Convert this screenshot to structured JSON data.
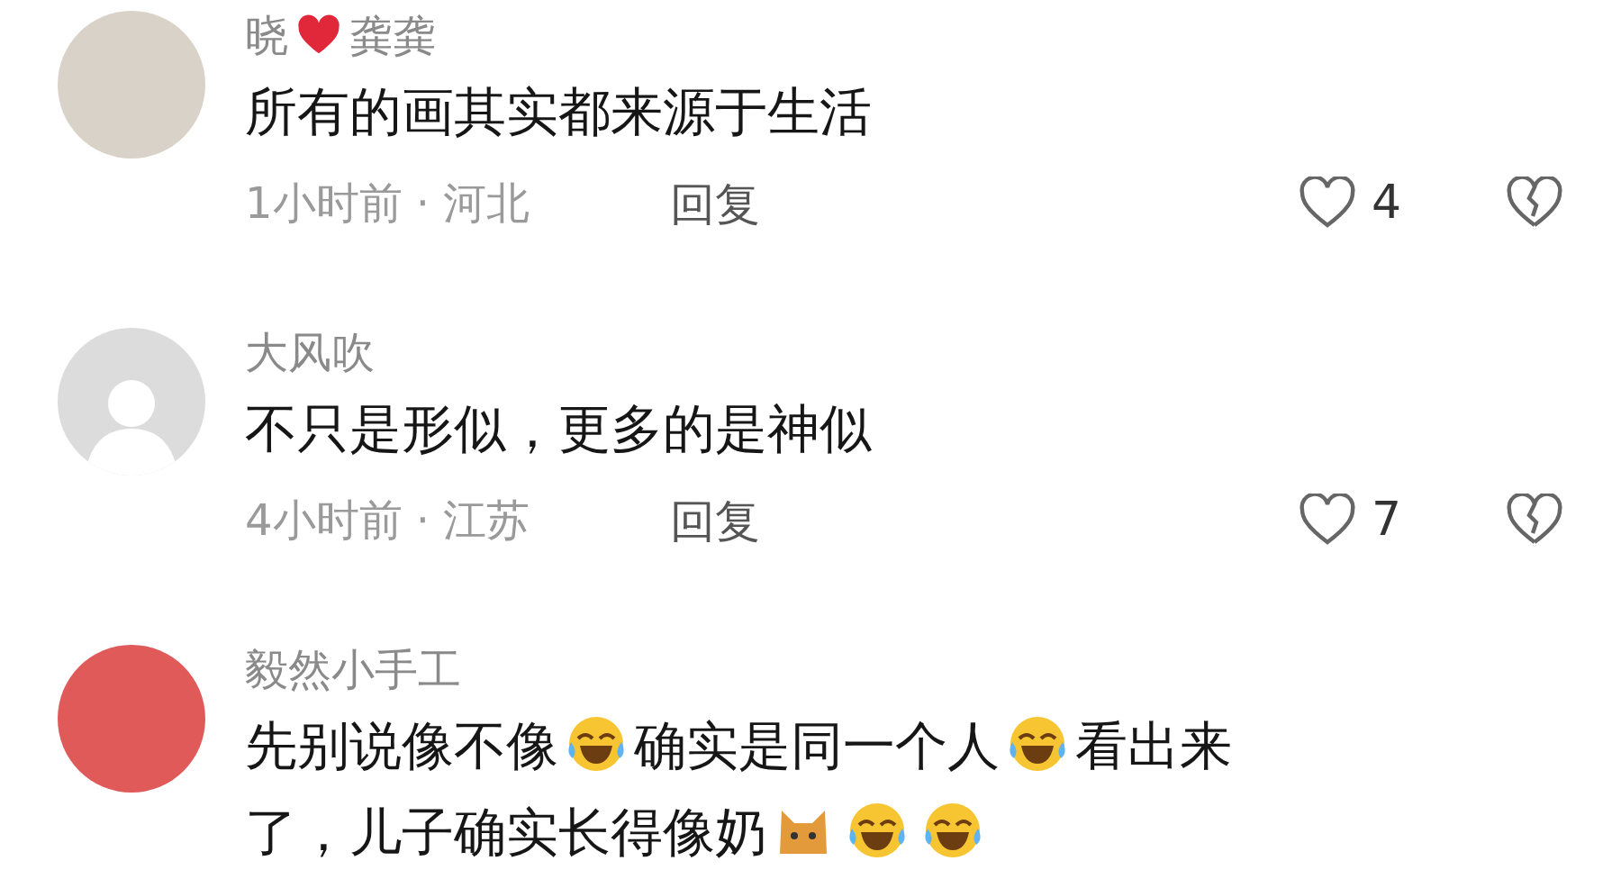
{
  "comments": [
    {
      "avatar": {
        "kind": "photo"
      },
      "name": [
        {
          "kind": "text",
          "text": "晓"
        },
        {
          "kind": "heart"
        },
        {
          "kind": "text",
          "text": "龚龚"
        }
      ],
      "content": [
        {
          "kind": "text",
          "text": "所有的画其实都来源于生活"
        }
      ],
      "time": "1小时前 · 河北",
      "reply": "回复",
      "liked": false,
      "likes": "4",
      "disliked": false
    },
    {
      "avatar": {
        "kind": "default"
      },
      "name": [
        {
          "kind": "text",
          "text": "大风吹"
        }
      ],
      "content": [
        {
          "kind": "text",
          "text": "不只是形似，更多的是神似"
        }
      ],
      "time": "4小时前 · 江苏",
      "reply": "回复",
      "liked": false,
      "likes": "7",
      "disliked": false
    },
    {
      "avatar": {
        "kind": "photo"
      },
      "name": [
        {
          "kind": "text",
          "text": "毅然小手工"
        }
      ],
      "content": [
        {
          "kind": "text",
          "text": "先别说像不像"
        },
        {
          "kind": "laugh"
        },
        {
          "kind": "text",
          "text": "确实是同一个人"
        },
        {
          "kind": "laugh"
        },
        {
          "kind": "text",
          "text": "看出来"
        },
        {
          "kind": "text",
          "text": "了，儿子确实长得像奶"
        },
        {
          "kind": "cat"
        },
        {
          "kind": "laugh"
        },
        {
          "kind": "laugh"
        }
      ]
    }
  ]
}
